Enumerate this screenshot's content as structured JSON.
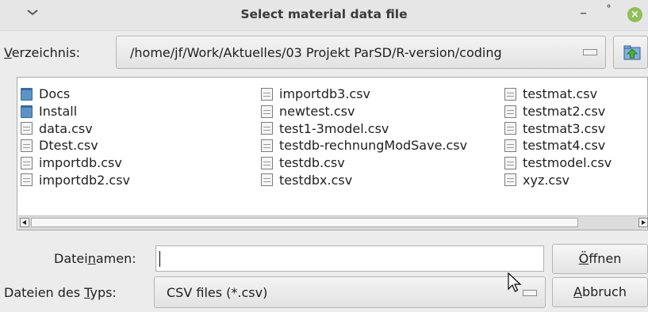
{
  "window": {
    "title": "Select material data file",
    "minimize_glyph": "–",
    "maximize_glyph": "˚",
    "close_glyph": "×"
  },
  "directory": {
    "label_accel": "V",
    "label_rest": "erzeichnis:",
    "path": "/home/jf/Work/Aktuelles/03 Projekt ParSD/R-version/coding"
  },
  "files": {
    "col1": [
      {
        "name": "Docs",
        "kind": "folder"
      },
      {
        "name": "Install",
        "kind": "folder"
      },
      {
        "name": "data.csv",
        "kind": "file"
      },
      {
        "name": "Dtest.csv",
        "kind": "file"
      },
      {
        "name": "importdb.csv",
        "kind": "file"
      },
      {
        "name": "importdb2.csv",
        "kind": "file"
      }
    ],
    "col2": [
      {
        "name": "importdb3.csv",
        "kind": "file"
      },
      {
        "name": "newtest.csv",
        "kind": "file"
      },
      {
        "name": "test1-3model.csv",
        "kind": "file"
      },
      {
        "name": "testdb-rechnungModSave.csv",
        "kind": "file"
      },
      {
        "name": "testdb.csv",
        "kind": "file"
      },
      {
        "name": "testdbx.csv",
        "kind": "file"
      }
    ],
    "col3": [
      {
        "name": "testmat.csv",
        "kind": "file"
      },
      {
        "name": "testmat2.csv",
        "kind": "file"
      },
      {
        "name": "testmat3.csv",
        "kind": "file"
      },
      {
        "name": "testmat4.csv",
        "kind": "file"
      },
      {
        "name": "testmodel.csv",
        "kind": "file"
      },
      {
        "name": "xyz.csv",
        "kind": "file"
      }
    ]
  },
  "filename": {
    "label_pre": "Datei",
    "label_accel": "n",
    "label_post": "amen:",
    "value": ""
  },
  "filetype": {
    "label_pre": "Dateien des ",
    "label_accel": "T",
    "label_post": "yps:",
    "selected": "CSV files (*.csv)"
  },
  "buttons": {
    "open_accel": "Ö",
    "open_rest": "ffnen",
    "cancel_accel": "A",
    "cancel_rest": "bbruch"
  },
  "icons": {
    "folder": "folder-icon",
    "file": "file-icon",
    "up": "folder-up-icon"
  },
  "colors": {
    "close_button": "#8fbf57",
    "folder": "#5b93c9"
  }
}
